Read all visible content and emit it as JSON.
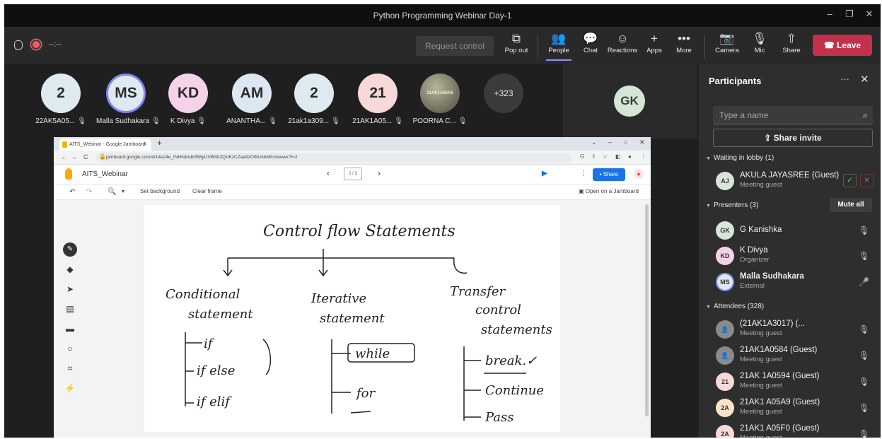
{
  "window": {
    "title": "Python Programming Webinar Day-1"
  },
  "toolbar": {
    "timer": "--:--",
    "request_control": "Request control",
    "buttons": {
      "popout": "Pop out",
      "people": "People",
      "chat": "Chat",
      "reactions": "Reactions",
      "apps": "Apps",
      "more": "More",
      "camera": "Camera",
      "mic": "Mic",
      "share": "Share"
    },
    "leave": "Leave"
  },
  "tiles": [
    {
      "initials": "2",
      "name": "22AK5A05...",
      "color": "#dfeaf0"
    },
    {
      "initials": "MS",
      "name": "Malla Sudhakara",
      "color": "#dfeaf0"
    },
    {
      "initials": "KD",
      "name": "K Divya",
      "color": "#f4d3ea"
    },
    {
      "initials": "AM",
      "name": "ANANTHA...",
      "color": "#dde7f2"
    },
    {
      "initials": "2",
      "name": "21ak1a309...",
      "color": "#dfeaf0"
    },
    {
      "initials": "21",
      "name": "21AK1A05...",
      "color": "#f7d9d9"
    },
    {
      "initials": "21AK1A05A5",
      "name": "POORNA C...",
      "color": "#6c6a58"
    }
  ],
  "overflow_count": "+323",
  "spotlight": {
    "initials": "GK"
  },
  "browser": {
    "tab_title": "AITS_Webinar - Google Jamboard",
    "url": "jamboard.google.com/d/14e24e_tNHhdAdl/358yUVBN02QVKzCZaa9zOlNUkbMfc/viewer?f=2"
  },
  "jamboard": {
    "title": "AITS_Webinar",
    "pager": "2 / 3",
    "share": "Share",
    "set_background": "Set background",
    "clear_frame": "Clear frame",
    "open_on_jamboard": "Open on a Jamboard"
  },
  "whiteboard": {
    "heading": "Control flow Statements",
    "columns": [
      {
        "title_line1": "Conditional",
        "title_line2": "statement",
        "items": [
          "if",
          "if else",
          "if elif"
        ]
      },
      {
        "title_line1": "Iterative",
        "title_line2": "statement",
        "items": [
          "while",
          "for"
        ]
      },
      {
        "title_line1": "Transfer",
        "title_line2": "control",
        "title_line3": "statements",
        "items": [
          "break.✓",
          "Continue",
          "Pass"
        ]
      }
    ]
  },
  "panel": {
    "title": "Participants",
    "search_placeholder": "Type a name",
    "share_invite": "Share invite",
    "lobby_header": "Waiting in lobby (1)",
    "presenters_header": "Presenters (3)",
    "mute_all": "Mute all",
    "attendees_header": "Attendees (328)",
    "lobby": [
      {
        "initials": "AJ",
        "name": "AKULA JAYASREE (Guest)",
        "role": "Meeting guest",
        "color": "#d8e6d8"
      }
    ],
    "presenters": [
      {
        "initials": "GK",
        "name": "G Kanishka",
        "role": "",
        "color": "#d8e6d8"
      },
      {
        "initials": "KD",
        "name": "K Divya",
        "role": "Organizer",
        "color": "#f4d3ea"
      },
      {
        "initials": "MS",
        "name": "Malla Sudhakara",
        "role": "External",
        "color": "#dfeaf0"
      }
    ],
    "attendees": [
      {
        "initials": "",
        "name": "(21AK1A3017) (...",
        "role": "Meeting guest",
        "color": "#8a8a8a"
      },
      {
        "initials": "",
        "name": "21AK1A0584 (Guest)",
        "role": "Meeting guest",
        "color": "#8a8a8a"
      },
      {
        "initials": "21",
        "name": "21AK 1A0594 (Guest)",
        "role": "Meeting guest",
        "color": "#f7d9d9"
      },
      {
        "initials": "2A",
        "name": "21AK1 A05A9 (Guest)",
        "role": "Meeting guest",
        "color": "#fde2c8"
      },
      {
        "initials": "2A",
        "name": "21AK1 A05F0 (Guest)",
        "role": "Meeting guest",
        "color": "#f7d9d9"
      }
    ]
  }
}
